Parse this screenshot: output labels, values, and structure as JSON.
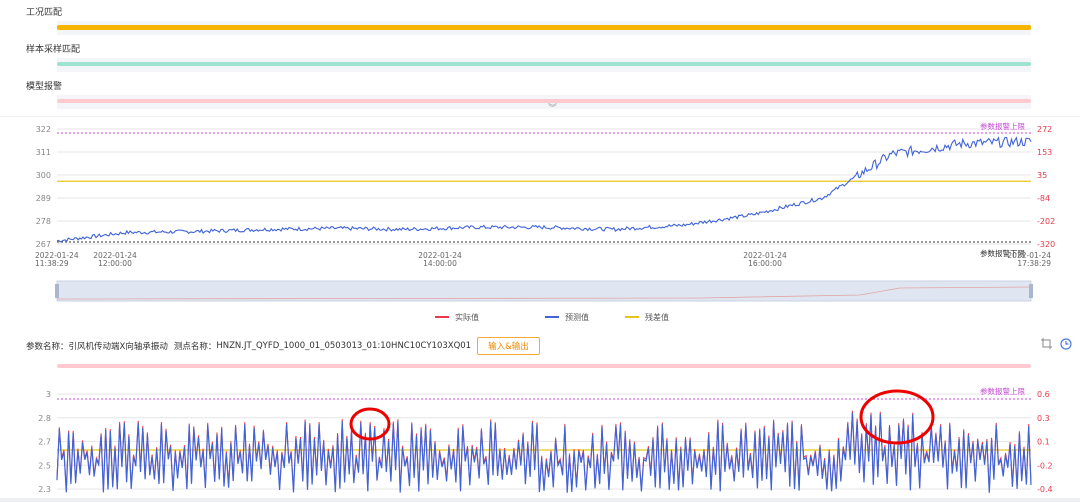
{
  "sections": {
    "condition_match": {
      "label": "工况匹配",
      "color": "#f5b400"
    },
    "sample_match": {
      "label": "样本采样匹配",
      "color": "#9de3cf"
    },
    "model_alarm": {
      "label": "模型报警",
      "color": "#ffc9cf"
    }
  },
  "collapse_icon": "chevron-double-down",
  "chart_data": [
    {
      "type": "line",
      "y_left_ticks": [
        "322",
        "311",
        "300",
        "289",
        "278",
        "267"
      ],
      "y_right_ticks": [
        "272",
        "153",
        "35",
        "-84",
        "-202",
        "-320"
      ],
      "ylim_left": [
        267,
        322
      ],
      "ylim_right": [
        -320,
        272
      ],
      "x_ticks": [
        {
          "date": "2022-01-24",
          "time": "11:38:29"
        },
        {
          "date": "2022-01-24",
          "time": "12:00:00"
        },
        {
          "date": "2022-01-24",
          "time": "14:00:00"
        },
        {
          "date": "2022-01-24",
          "time": "16:00:00"
        },
        {
          "date": "2022-01-24",
          "time": "17:38:29"
        }
      ],
      "upper_limit_label": "参数报警上限",
      "lower_limit_label": "参数报警下限",
      "series": [
        {
          "name": "实际值",
          "color": "#e8394a"
        },
        {
          "name": "预测值",
          "color": "#4063d8"
        },
        {
          "name": "残差值",
          "color": "#e6c51a"
        }
      ],
      "residual_level": 297,
      "predicted_profile": [
        {
          "x": "11:38",
          "y": 268.5
        },
        {
          "x": "12:00",
          "y": 272.5
        },
        {
          "x": "12:30",
          "y": 273
        },
        {
          "x": "13:00",
          "y": 274
        },
        {
          "x": "13:30",
          "y": 274.5
        },
        {
          "x": "14:00",
          "y": 274
        },
        {
          "x": "14:30",
          "y": 275
        },
        {
          "x": "15:00",
          "y": 275
        },
        {
          "x": "15:30",
          "y": 274
        },
        {
          "x": "16:00",
          "y": 276
        },
        {
          "x": "16:30",
          "y": 281
        },
        {
          "x": "16:50",
          "y": 289
        },
        {
          "x": "17:00",
          "y": 310
        },
        {
          "x": "17:10",
          "y": 315
        },
        {
          "x": "17:38",
          "y": 316
        }
      ]
    },
    {
      "type": "line",
      "y_left_ticks": [
        "3",
        "2.8",
        "2.7",
        "2.5",
        "2.3"
      ],
      "y_right_ticks": [
        "0.6",
        "0.3",
        "0.1",
        "-0.2",
        "-0.4"
      ],
      "upper_limit_label": "参数报警上限",
      "highlighted_spikes": 2
    }
  ],
  "legend": [
    {
      "name": "实际值",
      "color": "#e8394a"
    },
    {
      "name": "预测值",
      "color": "#4063d8"
    },
    {
      "name": "残差值",
      "color": "#e6c51a"
    }
  ],
  "param_info": {
    "param_label": "参数名称：",
    "param_name": "引风机传动端X向轴承振动",
    "point_label": "测点名称：",
    "point_name": "HNZN.JT_QYFD_1000_01_0503013_01:10HNC10CY103XQ01",
    "io_button": "输入&输出"
  },
  "toolbar_icons": [
    "crop-icon",
    "clock-icon"
  ]
}
